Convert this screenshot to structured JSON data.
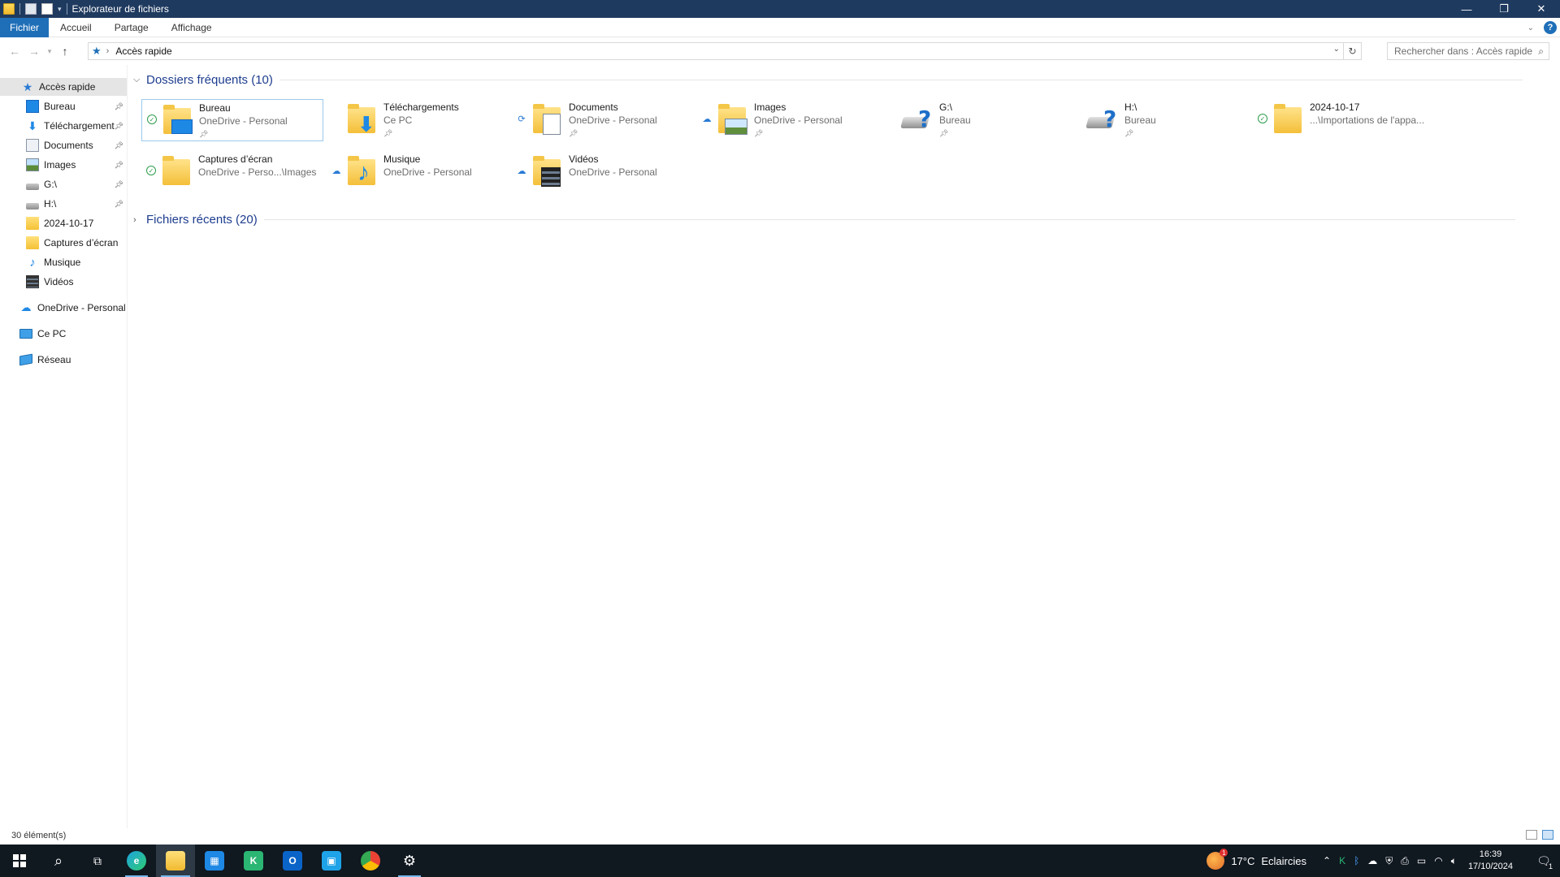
{
  "window": {
    "title": "Explorateur de fichiers",
    "controls": [
      "—",
      "❐",
      "✕"
    ]
  },
  "ribbon": {
    "tabs": [
      "Fichier",
      "Accueil",
      "Partage",
      "Affichage"
    ]
  },
  "address": {
    "path": "Accès rapide",
    "search_placeholder": "Rechercher dans : Accès rapide"
  },
  "nav": {
    "items": [
      {
        "label": "Accès rapide",
        "icon": "star-icon"
      },
      {
        "label": "Bureau",
        "icon": "desktop-icon",
        "pinned": true
      },
      {
        "label": "Téléchargements",
        "icon": "download-icon",
        "pinned": true
      },
      {
        "label": "Documents",
        "icon": "documents-icon",
        "pinned": true
      },
      {
        "label": "Images",
        "icon": "pictures-icon",
        "pinned": true
      },
      {
        "label": "G:\\",
        "icon": "drive-icon",
        "pinned": true
      },
      {
        "label": "H:\\",
        "icon": "drive-icon",
        "pinned": true
      },
      {
        "label": "2024-10-17",
        "icon": "folder-icon"
      },
      {
        "label": "Captures d’écran",
        "icon": "folder-icon"
      },
      {
        "label": "Musique",
        "icon": "music-icon"
      },
      {
        "label": "Vidéos",
        "icon": "videos-icon"
      },
      {
        "label": "OneDrive - Personal",
        "icon": "onedrive-icon"
      },
      {
        "label": "Ce PC",
        "icon": "pc-icon"
      },
      {
        "label": "Réseau",
        "icon": "network-icon"
      }
    ]
  },
  "frequent": {
    "header": "Dossiers fréquents (10)",
    "tiles": [
      {
        "name": "Bureau",
        "sub": "OneDrive - Personal",
        "status": "synced",
        "pinned": true
      },
      {
        "name": "Téléchargements",
        "sub": "Ce PC",
        "status": "",
        "pinned": true
      },
      {
        "name": "Documents",
        "sub": "OneDrive - Personal",
        "status": "syncing",
        "pinned": true
      },
      {
        "name": "Images",
        "sub": "OneDrive - Personal",
        "status": "cloud",
        "pinned": true
      },
      {
        "name": "G:\\",
        "sub": "Bureau",
        "status": "",
        "pinned": true
      },
      {
        "name": "H:\\",
        "sub": "Bureau",
        "status": "",
        "pinned": true
      },
      {
        "name": "2024-10-17",
        "sub": "...\\Importations de l'appa...",
        "status": "synced",
        "pinned": false
      },
      {
        "name": "Captures d’écran",
        "sub": "OneDrive - Perso...\\Images",
        "status": "synced",
        "pinned": false
      },
      {
        "name": "Musique",
        "sub": "OneDrive - Personal",
        "status": "cloud",
        "pinned": false
      },
      {
        "name": "Vidéos",
        "sub": "OneDrive - Personal",
        "status": "cloud",
        "pinned": false
      }
    ]
  },
  "recent": {
    "header": "Fichiers récents (20)"
  },
  "statusbar": {
    "count": "30 élément(s)"
  },
  "taskbar": {
    "weather_temp": "17°C",
    "weather_text": "Eclaircies",
    "weather_badge": "1",
    "time": "16:39",
    "date": "17/10/2024",
    "notif_count": "1"
  },
  "colors": {
    "titlebar": "#1f3a5f",
    "accent": "#1f6fb8",
    "section_header": "#1e3d8f"
  }
}
